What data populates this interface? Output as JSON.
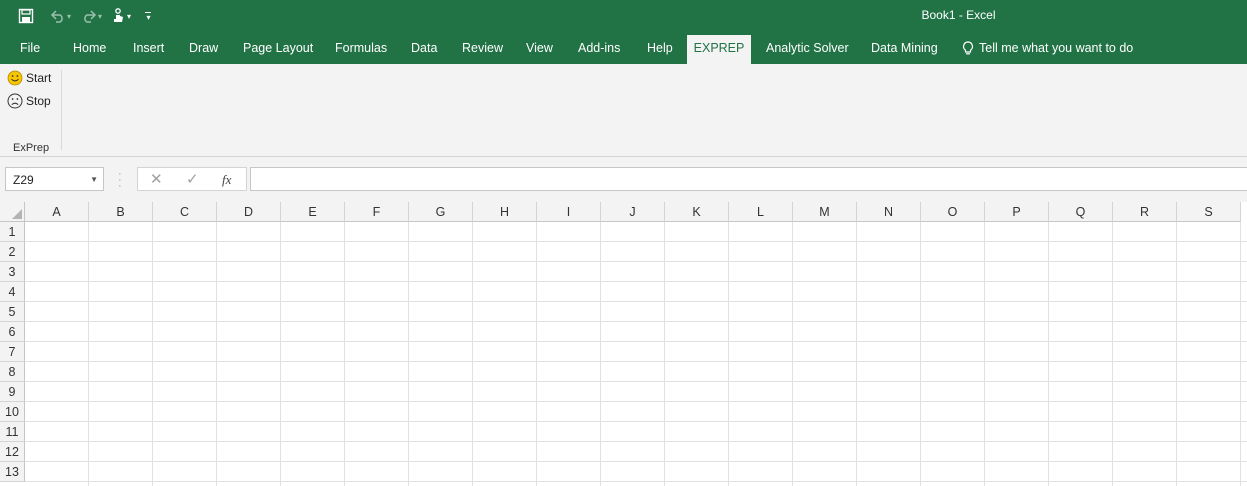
{
  "window": {
    "title": "Book1  -  Excel"
  },
  "qat": {
    "icons": [
      "save-icon",
      "undo-icon",
      "redo-icon",
      "touch-mode-icon",
      "customize-qat-icon"
    ],
    "more_glyph": "▾"
  },
  "tabs": [
    {
      "label": "File"
    },
    {
      "label": "Home"
    },
    {
      "label": "Insert"
    },
    {
      "label": "Draw"
    },
    {
      "label": "Page Layout"
    },
    {
      "label": "Formulas"
    },
    {
      "label": "Data"
    },
    {
      "label": "Review"
    },
    {
      "label": "View"
    },
    {
      "label": "Add-ins"
    },
    {
      "label": "Help"
    },
    {
      "label": "EXPREP",
      "active": true
    },
    {
      "label": "Analytic Solver"
    },
    {
      "label": "Data Mining"
    }
  ],
  "tell_me": {
    "label": "Tell me what you want to do",
    "icon": "lightbulb-icon"
  },
  "ribbon": {
    "start_label": "Start",
    "stop_label": "Stop",
    "group_label": "ExPrep"
  },
  "formula_bar": {
    "name_box": "Z29",
    "fx_label": "fx",
    "value": ""
  },
  "grid": {
    "columns": [
      "A",
      "B",
      "C",
      "D",
      "E",
      "F",
      "G",
      "H",
      "I",
      "J",
      "K",
      "L",
      "M",
      "N",
      "O",
      "P",
      "Q",
      "R",
      "S"
    ],
    "rows": [
      "1",
      "2",
      "3",
      "4",
      "5",
      "6",
      "7",
      "8",
      "9",
      "10",
      "11",
      "12",
      "13"
    ]
  },
  "colors": {
    "brand": "#217346",
    "ribbon_bg": "#f3f3f3",
    "grid_line": "#e1e1e1"
  }
}
